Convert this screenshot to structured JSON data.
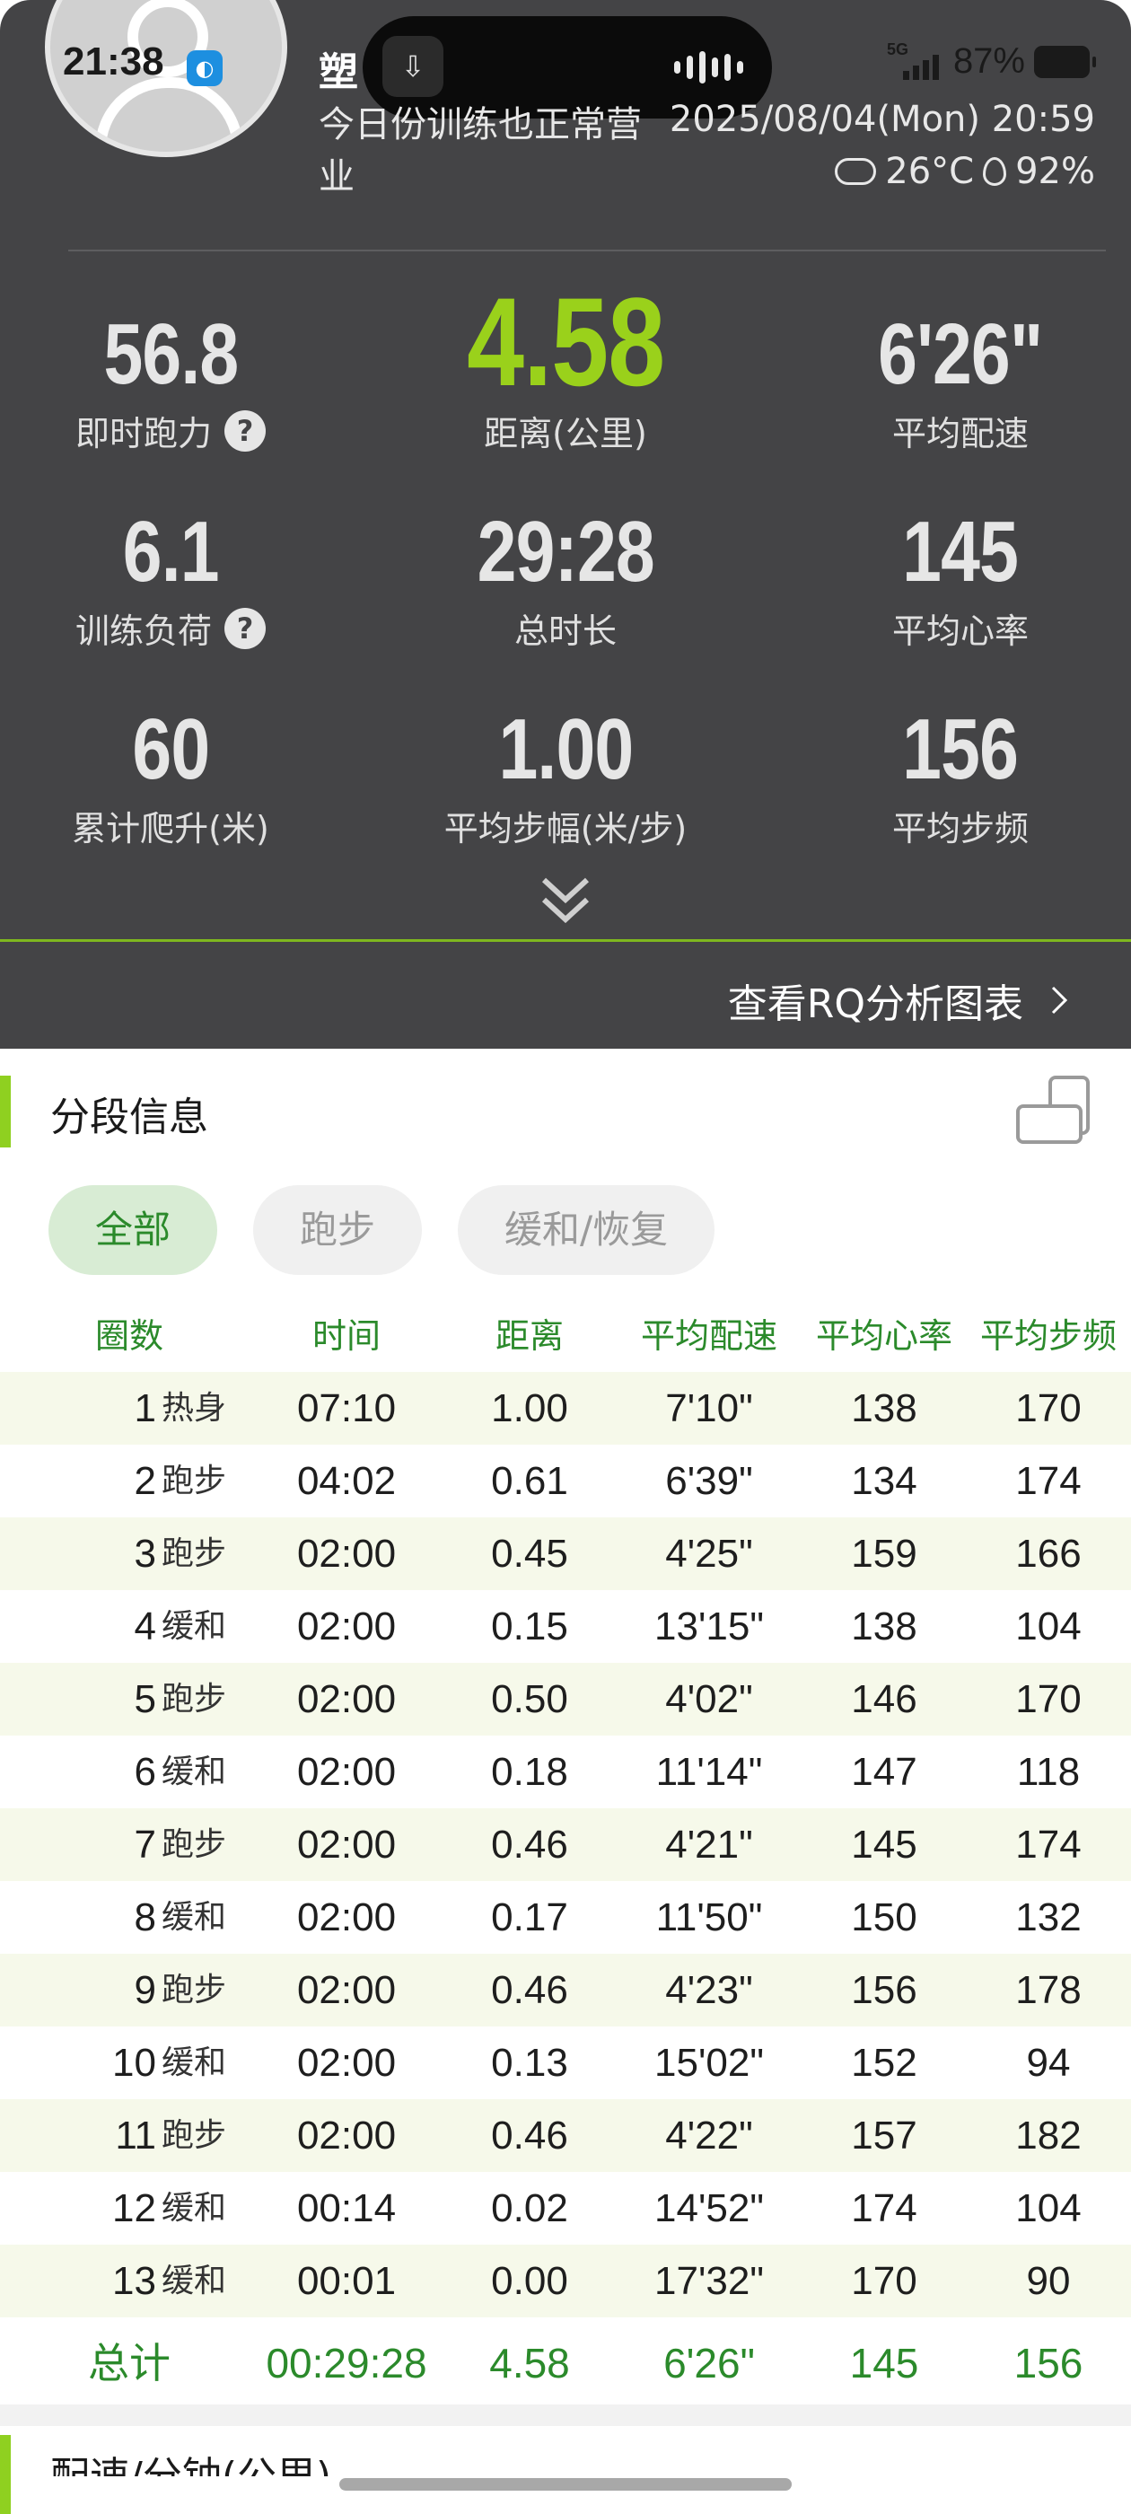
{
  "status_bar": {
    "time": "21:38",
    "network": "5G",
    "battery": "87%"
  },
  "header": {
    "name": "塑",
    "description": "今日份训练也正常营业",
    "datetime": "2025/08/04(Mon) 20:59",
    "temperature": "26°C",
    "humidity": "92%"
  },
  "stats": [
    {
      "value": "56.8",
      "label": "即时跑力",
      "help": "?"
    },
    {
      "value": "4.58",
      "label": "距离(公里)"
    },
    {
      "value": "6'26\"",
      "label": "平均配速"
    },
    {
      "value": "6.1",
      "label": "训练负荷",
      "help": "?"
    },
    {
      "value": "29:28",
      "label": "总时长"
    },
    {
      "value": "145",
      "label": "平均心率"
    },
    {
      "value": "60",
      "label": "累计爬升(米)"
    },
    {
      "value": "1.00",
      "label": "平均步幅(米/步)"
    },
    {
      "value": "156",
      "label": "平均步频"
    }
  ],
  "rq_link": "查看RQ分析图表",
  "segment": {
    "title": "分段信息",
    "filters": [
      "全部",
      "跑步",
      "缓和/恢复"
    ],
    "headers": [
      "圈数",
      "时间",
      "距离",
      "平均配速",
      "平均心率",
      "平均步频"
    ],
    "rows": [
      {
        "n": "1",
        "kind": "热身",
        "time": "07:10",
        "dist": "1.00",
        "pace": "7'10\"",
        "hr": "138",
        "cad": "170"
      },
      {
        "n": "2",
        "kind": "跑步",
        "time": "04:02",
        "dist": "0.61",
        "pace": "6'39\"",
        "hr": "134",
        "cad": "174"
      },
      {
        "n": "3",
        "kind": "跑步",
        "time": "02:00",
        "dist": "0.45",
        "pace": "4'25\"",
        "hr": "159",
        "cad": "166"
      },
      {
        "n": "4",
        "kind": "缓和",
        "time": "02:00",
        "dist": "0.15",
        "pace": "13'15\"",
        "hr": "138",
        "cad": "104"
      },
      {
        "n": "5",
        "kind": "跑步",
        "time": "02:00",
        "dist": "0.50",
        "pace": "4'02\"",
        "hr": "146",
        "cad": "170"
      },
      {
        "n": "6",
        "kind": "缓和",
        "time": "02:00",
        "dist": "0.18",
        "pace": "11'14\"",
        "hr": "147",
        "cad": "118"
      },
      {
        "n": "7",
        "kind": "跑步",
        "time": "02:00",
        "dist": "0.46",
        "pace": "4'21\"",
        "hr": "145",
        "cad": "174"
      },
      {
        "n": "8",
        "kind": "缓和",
        "time": "02:00",
        "dist": "0.17",
        "pace": "11'50\"",
        "hr": "150",
        "cad": "132"
      },
      {
        "n": "9",
        "kind": "跑步",
        "time": "02:00",
        "dist": "0.46",
        "pace": "4'23\"",
        "hr": "156",
        "cad": "178"
      },
      {
        "n": "10",
        "kind": "缓和",
        "time": "02:00",
        "dist": "0.13",
        "pace": "15'02\"",
        "hr": "152",
        "cad": "94"
      },
      {
        "n": "11",
        "kind": "跑步",
        "time": "02:00",
        "dist": "0.46",
        "pace": "4'22\"",
        "hr": "157",
        "cad": "182"
      },
      {
        "n": "12",
        "kind": "缓和",
        "time": "00:14",
        "dist": "0.02",
        "pace": "14'52\"",
        "hr": "174",
        "cad": "104"
      },
      {
        "n": "13",
        "kind": "缓和",
        "time": "00:01",
        "dist": "0.00",
        "pace": "17'32\"",
        "hr": "170",
        "cad": "90"
      }
    ],
    "total": {
      "label": "总计",
      "time": "00:29:28",
      "dist": "4.58",
      "pace": "6'26\"",
      "hr": "145",
      "cad": "156"
    }
  },
  "next_section_title": "配速/分钟(公里)",
  "colors": {
    "accent_green": "#9ad11b",
    "table_green": "#2b8a2b",
    "card_dark": "#444446"
  }
}
